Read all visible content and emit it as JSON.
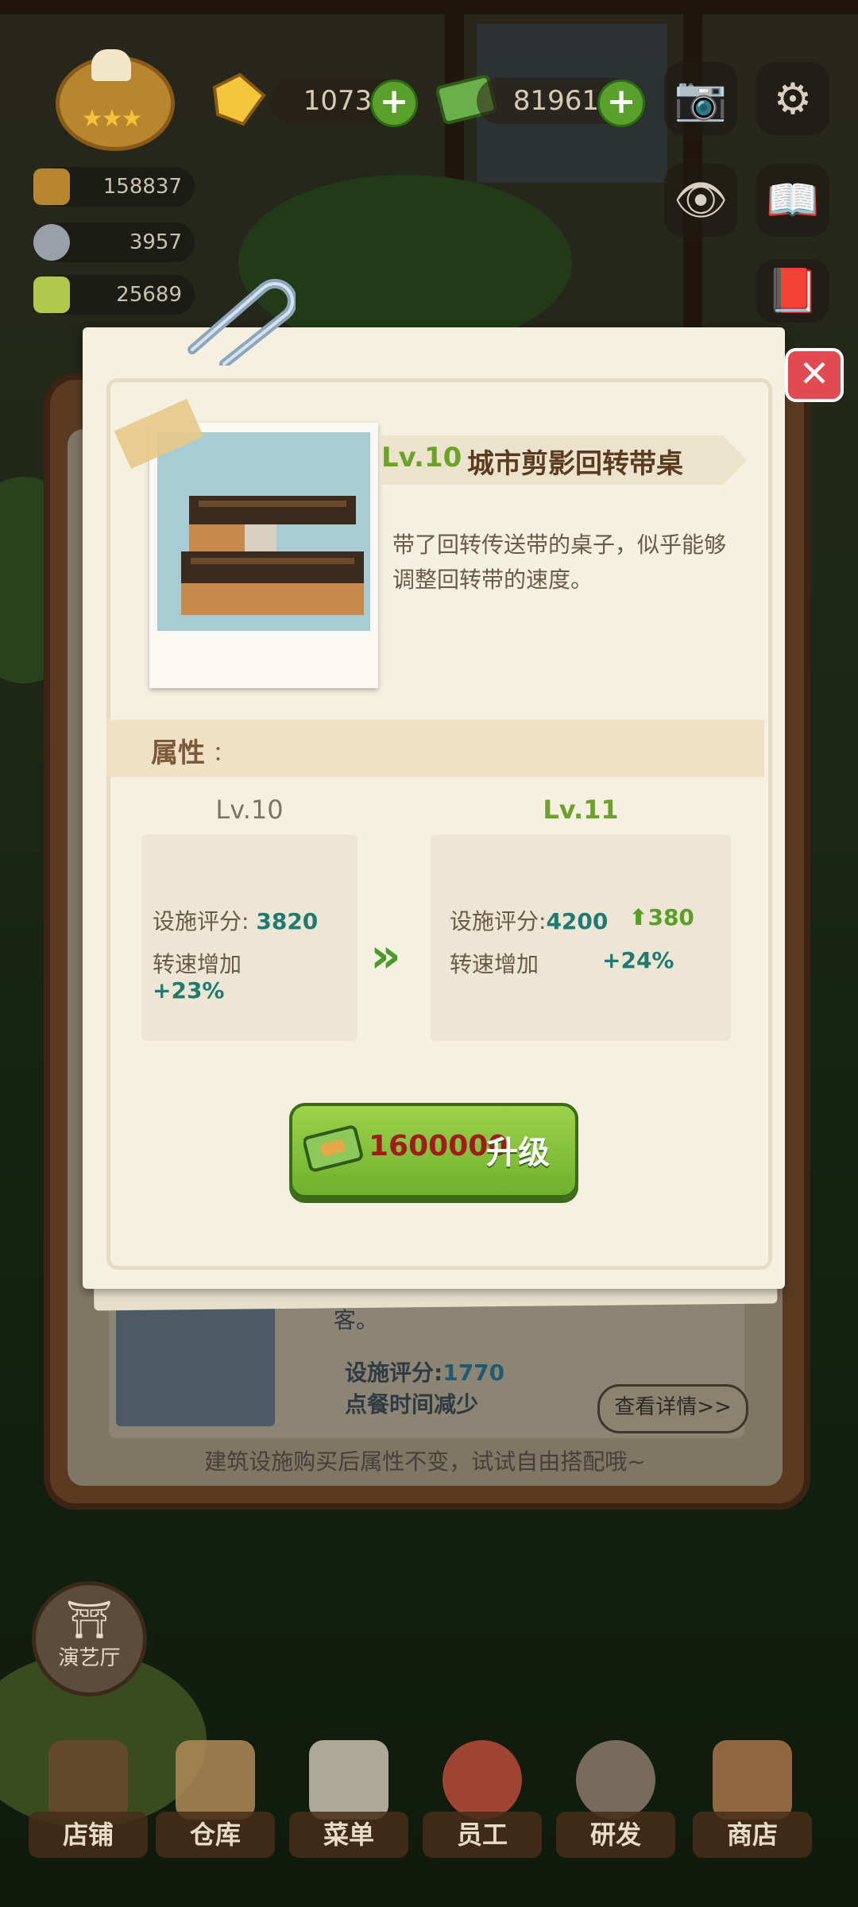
{
  "hud": {
    "gems": "1073",
    "cash": "81961",
    "stats": [
      "158837",
      "3957",
      "25689"
    ],
    "buttons": [
      "camera-icon",
      "gear-icon",
      "eye-icon",
      "guide-book-icon",
      "ledger-icon"
    ]
  },
  "dialog": {
    "level": "Lv.10",
    "name": "城市剪影回转带桌",
    "description": "带了回转传送带的桌子，似乎能够调整回转带的速度。",
    "attributes_label": "属性",
    "attributes_colon": "：",
    "current": {
      "level": "Lv.10",
      "rating_label": "设施评分",
      "rating_colon": ":",
      "rating_value": "3820",
      "speed_label": "转速增加",
      "speed_value": "+23%"
    },
    "next": {
      "level": "Lv.11",
      "rating_label": "设施评分",
      "rating_colon": ":",
      "rating_value": "4200",
      "rating_delta": "380",
      "speed_label": "转速增加",
      "speed_value": "+24%"
    },
    "upgrade": {
      "price": "1600000",
      "label": "升级"
    }
  },
  "underlying": {
    "text_fragment": "客。",
    "rating_label": "设施评分",
    "rating_colon": ":",
    "rating_value": "1770",
    "effect_label": "点餐时间减少",
    "details_button": "查看详情>>",
    "tip": "建筑设施购买后属性不变，试试自由搭配哦~"
  },
  "side_button": "演艺厅",
  "nav": [
    "店铺",
    "仓库",
    "菜单",
    "员工",
    "研发",
    "商店"
  ]
}
